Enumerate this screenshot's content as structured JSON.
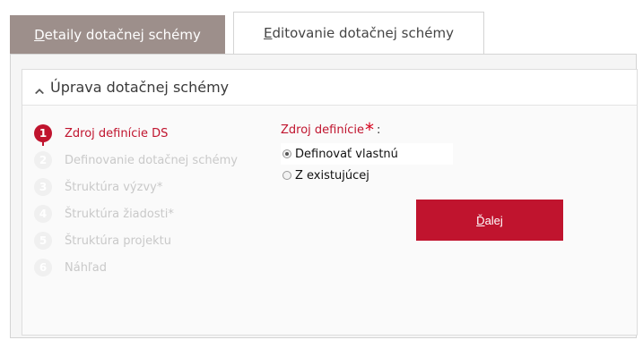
{
  "tabs": [
    {
      "label_accel": "D",
      "label_rest": "etaily dotačnej schémy",
      "active": true
    },
    {
      "label_accel": "E",
      "label_rest": "ditovanie dotačnej schémy",
      "active": false
    }
  ],
  "panel": {
    "title": "Úprava dotačnej schémy"
  },
  "steps": [
    {
      "number": "1",
      "label": "Zdroj definície DS",
      "active": true
    },
    {
      "number": "2",
      "label": "Definovanie dotačnej schémy",
      "active": false
    },
    {
      "number": "3",
      "label": "Štruktúra výzvy*",
      "active": false
    },
    {
      "number": "4",
      "label": "Štruktúra žiadosti*",
      "active": false
    },
    {
      "number": "5",
      "label": "Štruktúra projektu",
      "active": false
    },
    {
      "number": "6",
      "label": "Náhľad",
      "active": false
    }
  ],
  "form": {
    "label": "Zdroj definície",
    "required_mark": "*",
    "colon": ":",
    "options": [
      {
        "label": "Definovať vlastnú",
        "checked": true
      },
      {
        "label": "Z existujúcej",
        "checked": false
      }
    ]
  },
  "next_button": {
    "accel": "Ď",
    "rest": "alej"
  },
  "colors": {
    "accent": "#c0142e",
    "tab_active_bg": "#9d8f8b"
  }
}
